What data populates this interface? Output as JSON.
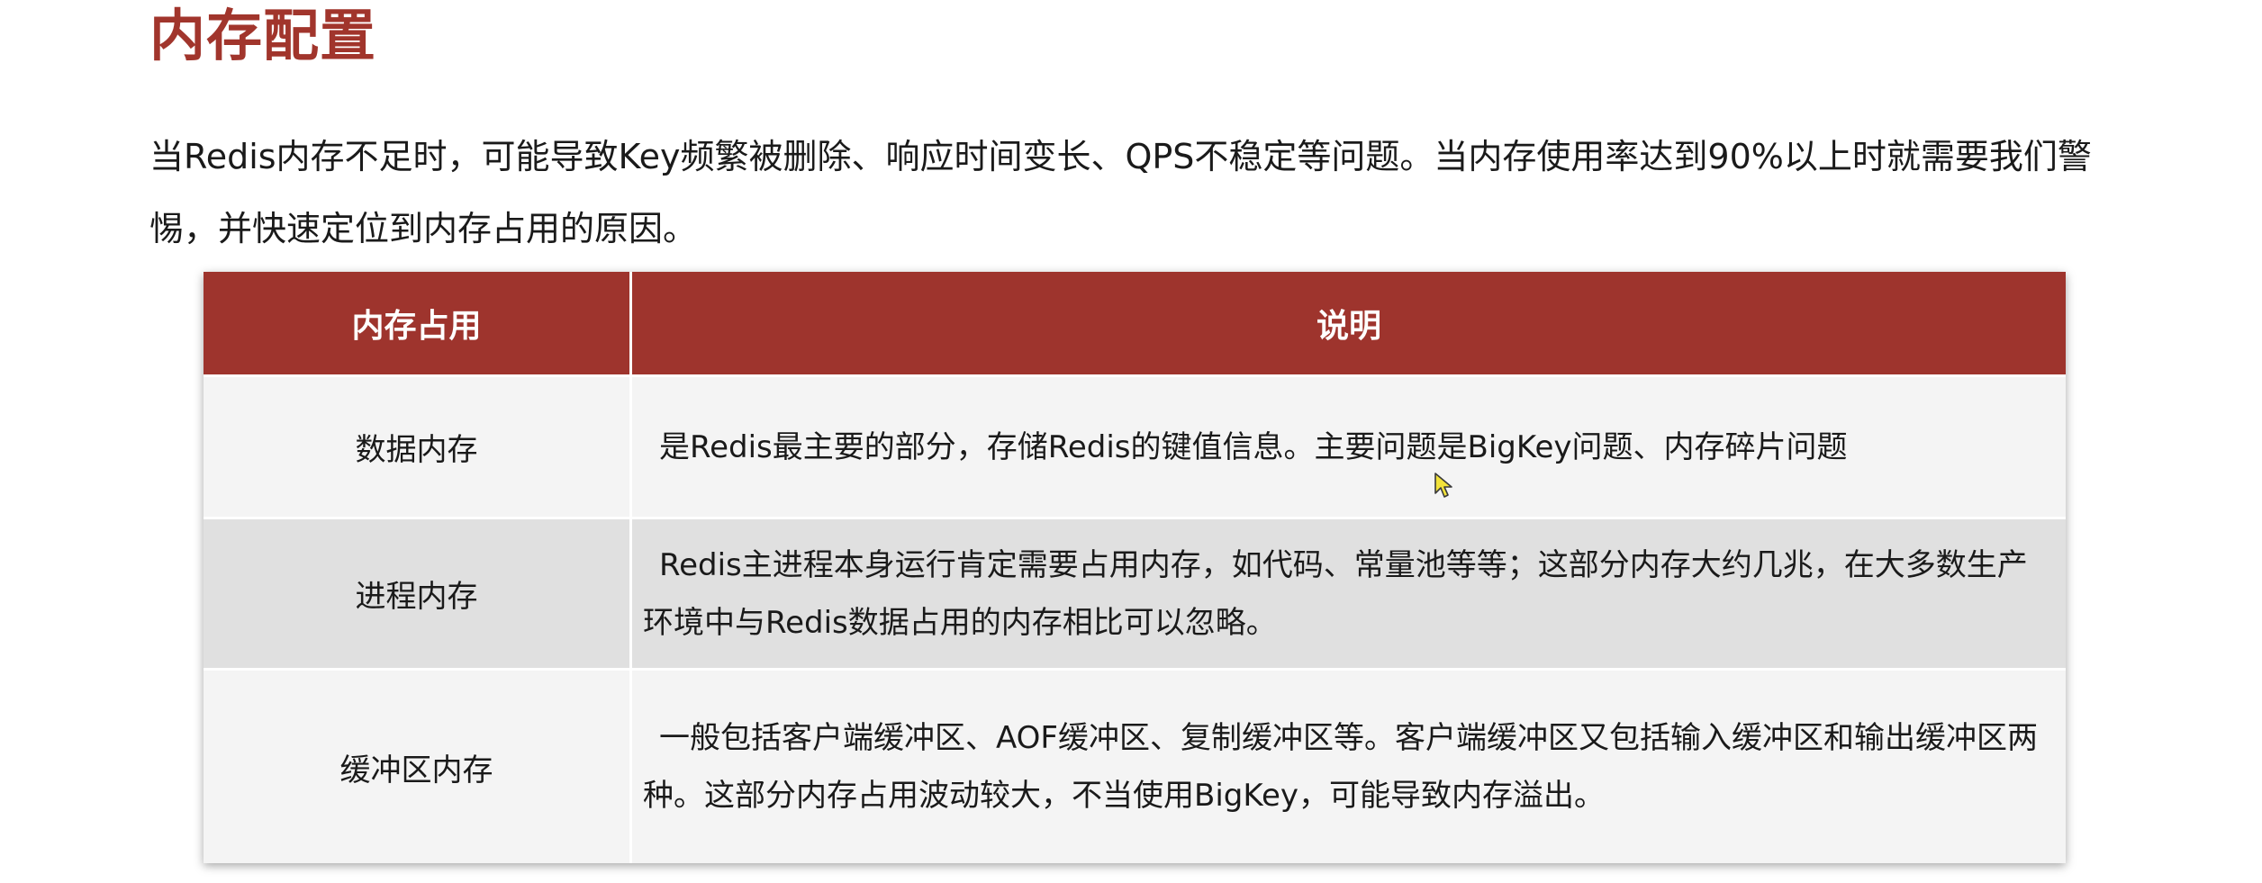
{
  "page": {
    "title": "内存配置",
    "intro": "当Redis内存不足时，可能导致Key频繁被删除、响应时间变长、QPS不稳定等问题。当内存使用率达到90%以上时就需要我们警惕，并快速定位到内存占用的原因。"
  },
  "table": {
    "headers": [
      "内存占用",
      "说明"
    ],
    "rows": [
      {
        "name": "数据内存",
        "desc": "是Redis最主要的部分，存储Redis的键值信息。主要问题是BigKey问题、内存碎片问题"
      },
      {
        "name": "进程内存",
        "desc": "Redis主进程本身运行肯定需要占用内存，如代码、常量池等等；这部分内存大约几兆，在大多数生产环境中与Redis数据占用的内存相比可以忽略。"
      },
      {
        "name": "缓冲区内存",
        "desc": "一般包括客户端缓冲区、AOF缓冲区、复制缓冲区等。客户端缓冲区又包括输入缓冲区和输出缓冲区两种。这部分内存占用波动较大，不当使用BigKey，可能导致内存溢出。"
      }
    ]
  },
  "colors": {
    "title": "#a1352c",
    "header_bg": "#9e342d",
    "row_light": "#f4f4f4",
    "row_dark": "#e0e0e0"
  }
}
